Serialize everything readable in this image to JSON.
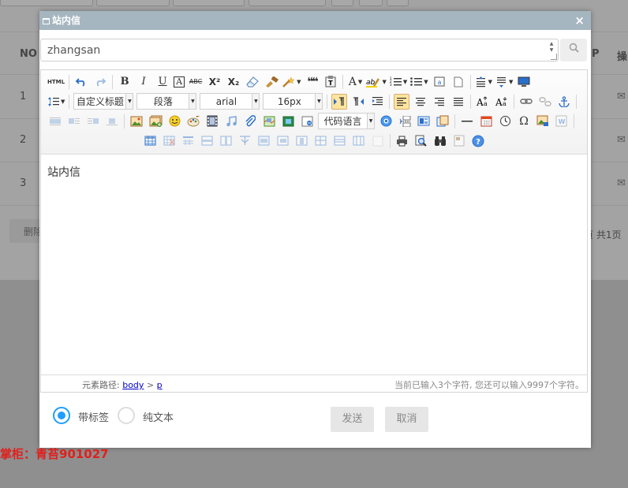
{
  "background": {
    "header_left": "NO",
    "header_right_1": "P",
    "header_right_2": "操",
    "rows": [
      "1",
      "2",
      "3"
    ],
    "mail_glyph": "✉",
    "delete_button": "删除",
    "pager": "页 共1页"
  },
  "dialog": {
    "title": "站内信",
    "close": "×",
    "recipient_value": "zhangsan",
    "toolbar": {
      "html_label": "HTML",
      "bold": "B",
      "italic": "I",
      "underline": "U",
      "fontborder": "A",
      "strikethrough": "ABC",
      "superscript": "X²",
      "subscript": "X₂",
      "blockquote": "❝❝",
      "forecolor": "A",
      "custom_heading": "自定义标题",
      "paragraph": "段落",
      "font_family": "arial",
      "font_size": "16px",
      "code_language": "代码语言",
      "omega": "Ω"
    },
    "content_text": "站内信",
    "status": {
      "path_label": "元素路径:",
      "path_body": "body",
      "path_sep": ">",
      "path_p": "p",
      "char_count": "当前已输入3个字符, 您还可以输入9997个字符。"
    },
    "radio_1": "带标签",
    "radio_2": "纯文本",
    "send_button": "发送",
    "cancel_button": "取消"
  },
  "watermark": "掌柜：青苔901027",
  "colors": {
    "accent": "#1e9fff",
    "title_bar": "#a5b6c0",
    "watermark": "#e0201c"
  }
}
